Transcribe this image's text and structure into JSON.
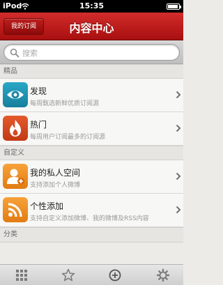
{
  "status_bar": {
    "carrier": "iPod",
    "time": "15:35",
    "battery_level": 0.9
  },
  "nav": {
    "left_button": "我的订阅",
    "title": "内容中心"
  },
  "search": {
    "placeholder": "搜索"
  },
  "sections": [
    {
      "header": "精品",
      "items": [
        {
          "title": "发现",
          "subtitle": "每周甄选新鲜优质订阅源",
          "icon": "eye-icon",
          "color": "#1f93b3"
        },
        {
          "title": "热门",
          "subtitle": "每周用户订阅最多的订阅源",
          "icon": "flame-icon",
          "color": "#d8471f"
        }
      ]
    },
    {
      "header": "自定义",
      "items": [
        {
          "title": "我的私人空间",
          "subtitle": "支持添加个人微博",
          "icon": "person-icon",
          "color": "#ef8f26"
        },
        {
          "title": "个性添加",
          "subtitle": "支持自定义添加微博、我的微博及RSS内容",
          "icon": "rss-icon",
          "color": "#ef8f26"
        }
      ]
    },
    {
      "header": "分类",
      "items": []
    }
  ],
  "tabs": [
    {
      "icon": "grid-icon"
    },
    {
      "icon": "star-icon"
    },
    {
      "icon": "add-icon"
    },
    {
      "icon": "settings-icon"
    }
  ],
  "colors": {
    "nav_red": "#b81a1a",
    "background": "#ecebe8"
  }
}
